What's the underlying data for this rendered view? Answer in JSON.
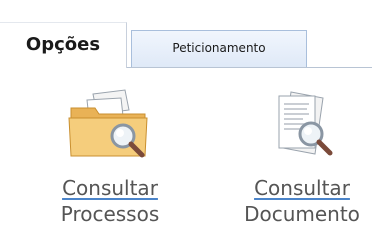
{
  "tabs": [
    {
      "label": "Opções",
      "active": true
    },
    {
      "label": "Peticionamento",
      "active": false
    }
  ],
  "tools": [
    {
      "line1": "Consultar",
      "line2": "Processos",
      "icon": "folder-search-icon"
    },
    {
      "line1": "Consultar",
      "line2": "Documento",
      "icon": "document-search-icon"
    }
  ],
  "colors": {
    "tab_border": "#a9bfdc",
    "link_underline": "#4b84c9",
    "label_text": "#555555",
    "folder": "#f2c46d"
  }
}
